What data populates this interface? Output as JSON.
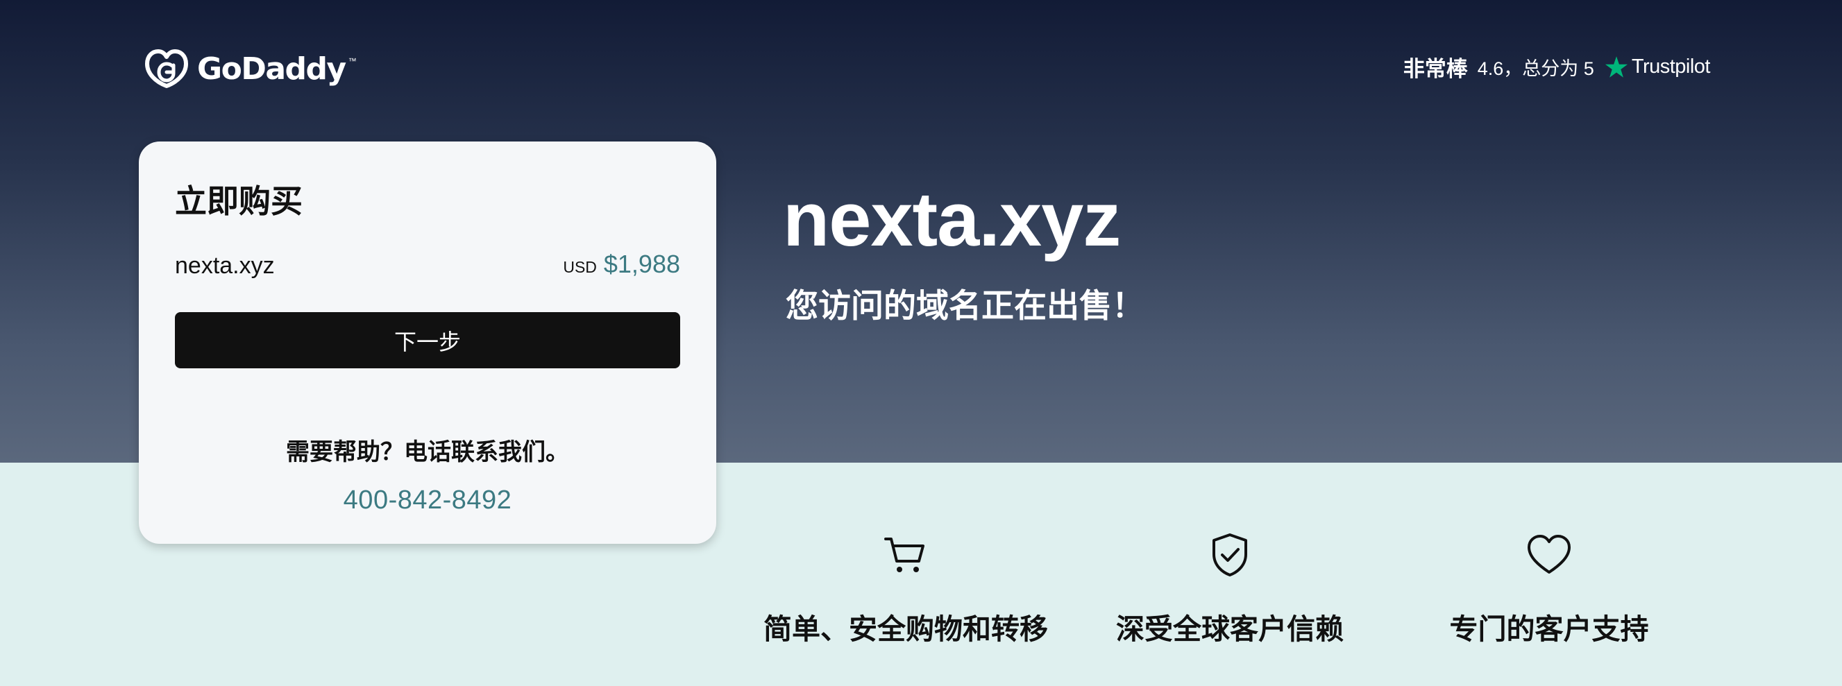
{
  "header": {
    "brand": "GoDaddy",
    "brand_tm": "™",
    "rating_label": "非常棒",
    "rating_score": "4.6，总分为 5",
    "trustpilot": "Trustpilot",
    "trustpilot_star_color": "#00b67a"
  },
  "card": {
    "title": "立即购买",
    "domain": "nexta.xyz",
    "currency": "USD",
    "price": "$1,988",
    "next_button": "下一步",
    "help_text": "需要帮助？电话联系我们。",
    "phone": "400-842-8492"
  },
  "hero": {
    "domain": "nexta.xyz",
    "subtitle": "您访问的域名正在出售！"
  },
  "features": [
    {
      "icon": "cart-icon",
      "label": "简单、安全购物和转移"
    },
    {
      "icon": "shield-check-icon",
      "label": "深受全球客户信赖"
    },
    {
      "icon": "heart-icon",
      "label": "专门的客户支持"
    }
  ],
  "colors": {
    "hero_top": "#121b36",
    "hero_bottom": "#5b687d",
    "lower_bg": "#dff0ef",
    "accent_teal": "#3c7a82",
    "button_bg": "#111111"
  }
}
